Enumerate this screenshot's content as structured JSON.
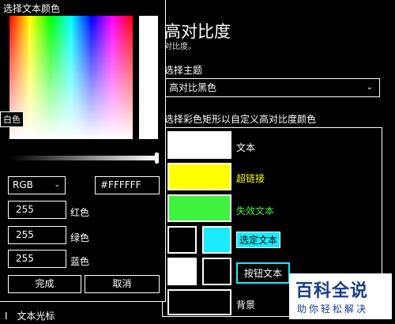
{
  "page": {
    "title": "高对比度",
    "subtitle": "对比度。",
    "theme_label": "选择主题",
    "theme_value": "高对比黑色",
    "colors_label": "选择彩色矩形以自定义高对比度颜色",
    "swatches": {
      "text": {
        "label": "文本",
        "color": "#ffffff"
      },
      "hyperlink": {
        "label": "超链接",
        "color": "#ffff00"
      },
      "disabled": {
        "label": "失效文本",
        "color": "#3ff23f"
      },
      "selected": {
        "label": "选定文本",
        "color": "#1aebff"
      },
      "button": {
        "label": "按钮文本",
        "color": "#ffffff"
      },
      "background": {
        "label": "背景",
        "color": "#000000"
      }
    }
  },
  "picker": {
    "title": "选择文本颜色",
    "tooltip": "白色",
    "mode": "RGB",
    "hex": "#FFFFFF",
    "red_value": "255",
    "red_label": "红色",
    "green_value": "255",
    "green_label": "绿色",
    "blue_value": "255",
    "blue_label": "蓝色",
    "done": "完成",
    "cancel": "取消",
    "brightness": 1.0
  },
  "nav": {
    "cursor_icon": "text-cursor-icon",
    "cursor_label": "文本光标"
  },
  "watermark": {
    "line1": "百科全说",
    "line2": "助你轻松解决"
  }
}
